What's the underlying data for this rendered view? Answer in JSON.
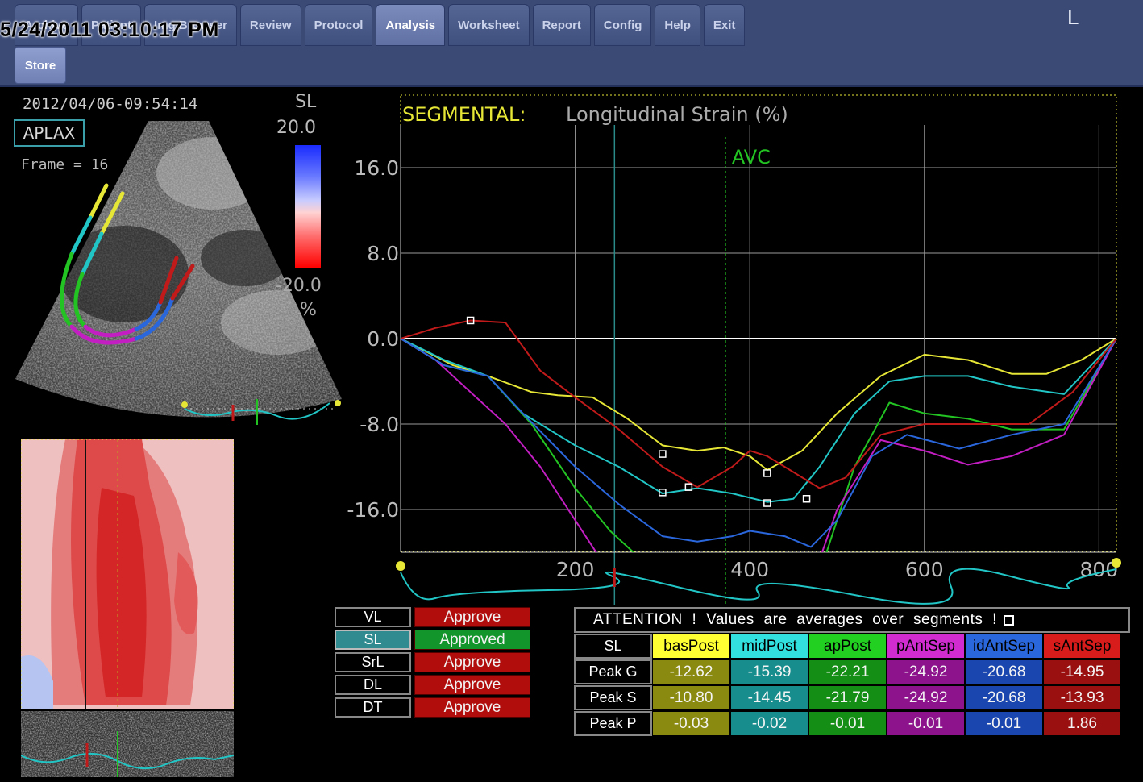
{
  "header": {
    "datetime": "5/24/2011 03:10:17 PM",
    "side_letter": "L",
    "tabs": [
      "Archive",
      "Patient",
      "Img Browser",
      "Review",
      "Protocol",
      "Analysis",
      "Worksheet",
      "Report",
      "Config",
      "Help",
      "Exit"
    ],
    "active_tab": "Analysis",
    "store_label": "Store"
  },
  "image_panel": {
    "scan_datetime": "2012/04/06-09:54:14",
    "view": "APLAX",
    "frame": "Frame = 16",
    "colorbar": {
      "title": "SL",
      "max": "20.0",
      "min": "-20.0",
      "unit": "%"
    }
  },
  "colors": {
    "basPost": "#e6e636",
    "midPost": "#22c5c5",
    "apPost": "#22c322",
    "apAntSept": "#c21ec2",
    "midAntSept": "#2a66dc",
    "basAntSept": "#c01a1a",
    "approve": "#b20d0d",
    "approved": "#12952a"
  },
  "chart_data": {
    "type": "line",
    "title": "SEGMENTAL:",
    "subtitle": "Longitudinal Strain (%)",
    "marker_label": "AVC",
    "avc_x": 372,
    "xlim": [
      0,
      820
    ],
    "ylim": [
      -20,
      20
    ],
    "xticks": [
      "200",
      "400",
      "600",
      "800"
    ],
    "xtick_values": [
      200,
      400,
      600,
      800
    ],
    "yticks": [
      "16.0",
      "8.0",
      "0.0",
      "-8.0",
      "-16.0"
    ],
    "ytick_values": [
      16,
      8,
      0,
      -8,
      -16
    ],
    "series": [
      {
        "name": "basPost",
        "color": "#e6e636",
        "points": [
          [
            0,
            0
          ],
          [
            60,
            -2.5
          ],
          [
            100,
            -3.5
          ],
          [
            150,
            -5
          ],
          [
            180,
            -5.3
          ],
          [
            220,
            -5.5
          ],
          [
            260,
            -7.5
          ],
          [
            300,
            -10
          ],
          [
            340,
            -10.5
          ],
          [
            370,
            -10.2
          ],
          [
            400,
            -11
          ],
          [
            420,
            -12.3
          ],
          [
            460,
            -10.5
          ],
          [
            500,
            -7
          ],
          [
            550,
            -3.5
          ],
          [
            600,
            -1.5
          ],
          [
            650,
            -2
          ],
          [
            700,
            -3.3
          ],
          [
            740,
            -3.3
          ],
          [
            780,
            -2
          ],
          [
            820,
            0
          ]
        ]
      },
      {
        "name": "midPost",
        "color": "#22c5c5",
        "points": [
          [
            0,
            0
          ],
          [
            50,
            -2
          ],
          [
            100,
            -3.5
          ],
          [
            140,
            -7
          ],
          [
            200,
            -10
          ],
          [
            250,
            -12
          ],
          [
            300,
            -14.5
          ],
          [
            340,
            -14
          ],
          [
            380,
            -14.5
          ],
          [
            420,
            -15.3
          ],
          [
            450,
            -15
          ],
          [
            480,
            -12
          ],
          [
            520,
            -7
          ],
          [
            560,
            -4
          ],
          [
            600,
            -3.5
          ],
          [
            650,
            -3.5
          ],
          [
            700,
            -4.5
          ],
          [
            760,
            -5.2
          ],
          [
            820,
            0
          ]
        ]
      },
      {
        "name": "apPost",
        "color": "#22c322",
        "points": [
          [
            0,
            0
          ],
          [
            50,
            -2.5
          ],
          [
            100,
            -3.5
          ],
          [
            150,
            -8
          ],
          [
            200,
            -14
          ],
          [
            240,
            -18
          ],
          [
            280,
            -21
          ],
          [
            320,
            -22.2
          ],
          [
            360,
            -21
          ],
          [
            400,
            -22
          ],
          [
            440,
            -22
          ],
          [
            480,
            -22
          ],
          [
            520,
            -12
          ],
          [
            560,
            -6
          ],
          [
            600,
            -7
          ],
          [
            650,
            -7.5
          ],
          [
            700,
            -8.5
          ],
          [
            760,
            -8.5
          ],
          [
            820,
            0
          ]
        ]
      },
      {
        "name": "apAntSept",
        "color": "#c21ec2",
        "points": [
          [
            0,
            0
          ],
          [
            40,
            -2
          ],
          [
            80,
            -5
          ],
          [
            120,
            -8
          ],
          [
            160,
            -12
          ],
          [
            200,
            -17
          ],
          [
            240,
            -22
          ],
          [
            280,
            -24.5
          ],
          [
            320,
            -24.9
          ],
          [
            360,
            -24.5
          ],
          [
            400,
            -24
          ],
          [
            440,
            -24.5
          ],
          [
            470,
            -23
          ],
          [
            500,
            -16
          ],
          [
            550,
            -9.5
          ],
          [
            600,
            -10.5
          ],
          [
            650,
            -11.8
          ],
          [
            700,
            -11
          ],
          [
            760,
            -9
          ],
          [
            820,
            0
          ]
        ]
      },
      {
        "name": "midAntSept",
        "color": "#2a66dc",
        "points": [
          [
            0,
            0
          ],
          [
            50,
            -2.5
          ],
          [
            100,
            -3.5
          ],
          [
            140,
            -7
          ],
          [
            200,
            -12
          ],
          [
            250,
            -15.5
          ],
          [
            300,
            -18.5
          ],
          [
            340,
            -19
          ],
          [
            380,
            -18.5
          ],
          [
            400,
            -18
          ],
          [
            440,
            -18.5
          ],
          [
            470,
            -19.5
          ],
          [
            500,
            -17
          ],
          [
            540,
            -11
          ],
          [
            580,
            -9
          ],
          [
            640,
            -10.3
          ],
          [
            700,
            -9
          ],
          [
            760,
            -8
          ],
          [
            820,
            0
          ]
        ]
      },
      {
        "name": "basAntSept",
        "color": "#c01a1a",
        "points": [
          [
            0,
            0
          ],
          [
            40,
            1
          ],
          [
            80,
            1.7
          ],
          [
            120,
            1.5
          ],
          [
            160,
            -3
          ],
          [
            200,
            -5.5
          ],
          [
            250,
            -8.5
          ],
          [
            300,
            -12
          ],
          [
            340,
            -13.9
          ],
          [
            380,
            -12
          ],
          [
            400,
            -10.5
          ],
          [
            420,
            -11
          ],
          [
            450,
            -12.5
          ],
          [
            480,
            -14
          ],
          [
            510,
            -13
          ],
          [
            550,
            -9
          ],
          [
            600,
            -8
          ],
          [
            660,
            -8
          ],
          [
            720,
            -8
          ],
          [
            770,
            -5
          ],
          [
            820,
            0
          ]
        ]
      }
    ],
    "peak_markers": [
      [
        80,
        1.7
      ],
      [
        300,
        -10.8
      ],
      [
        300,
        -14.4
      ],
      [
        330,
        -13.9
      ],
      [
        420,
        -12.6
      ],
      [
        420,
        -15.4
      ],
      [
        465,
        -15
      ]
    ]
  },
  "status_list": [
    {
      "name": "VL",
      "button": "Approve",
      "selected": false
    },
    {
      "name": "SL",
      "button": "Approved",
      "selected": true
    },
    {
      "name": "SrL",
      "button": "Approve",
      "selected": false
    },
    {
      "name": "DL",
      "button": "Approve",
      "selected": false
    },
    {
      "name": "DT",
      "button": "Approve",
      "selected": false
    }
  ],
  "segment_table": {
    "attention": "ATTENTION !   Values are averages over segments !",
    "corner": "SL",
    "headers": [
      "basPost",
      "midPost",
      "apPost",
      "pAntSep",
      "idAntSep",
      "sAntSep"
    ],
    "header_colors": [
      "#ffff33",
      "#33e0e0",
      "#22d022",
      "#d02cd0",
      "#2a66dc",
      "#d81c1c"
    ],
    "header_text_colors": [
      "#000",
      "#000",
      "#000",
      "#000",
      "#000",
      "#000"
    ],
    "cell_colors": [
      "#8a8a10",
      "#178d8d",
      "#158e15",
      "#8c138c",
      "#1a46b0",
      "#9a1010"
    ],
    "rows": [
      {
        "label": "Peak G",
        "values": [
          "-12.62",
          "-15.39",
          "-22.21",
          "-24.92",
          "-20.68",
          "-14.95"
        ]
      },
      {
        "label": "Peak S",
        "values": [
          "-10.80",
          "-14.45",
          "-21.79",
          "-24.92",
          "-20.68",
          "-13.93"
        ]
      },
      {
        "label": "Peak P",
        "values": [
          "-0.03",
          "-0.02",
          "-0.01",
          "-0.01",
          "-0.01",
          "1.86"
        ]
      }
    ]
  }
}
